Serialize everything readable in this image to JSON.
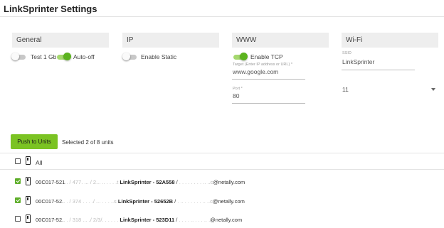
{
  "app": {
    "title": "LinkSprinter Settings"
  },
  "panels": {
    "general": {
      "header": "General",
      "test1gb_label": "Test 1 Gb",
      "autooff_label": "Auto-off",
      "test1gb_on": false,
      "autooff_on": true
    },
    "ip": {
      "header": "IP",
      "enable_static_label": "Enable Static",
      "enable_static_on": false
    },
    "www": {
      "header": "WWW",
      "enable_tcp_label": "Enable TCP",
      "enable_tcp_on": true,
      "target_label": "Target (Enter IP address or URL) *",
      "target_value": "www.google.com",
      "port_label": "Port *",
      "port_value": "80"
    },
    "wifi": {
      "header": "Wi-Fi",
      "ssid_label": "SSID",
      "ssid_value": "LinkSprinter",
      "channel_value": "11"
    }
  },
  "actions": {
    "push_label": "Push to Units",
    "selected_text": "Selected 2 of 8 units"
  },
  "units": {
    "all_label": "All",
    "rows": [
      {
        "checked": true,
        "id": "00C017-521",
        "mid": ".. / 477. ... / 2... .. . . . .t",
        "name": "LinkSprinter - 52A558",
        "sep": " / ",
        "email_blur": ". . . . . . . . .. ..c",
        "email": "@netally.com"
      },
      {
        "checked": true,
        "id": "00C017-52.",
        "mid": ". . / 374 . . . ./ ... . . . ..s",
        "name": "LinkSprinter - 52652B",
        "sep": " / ",
        "email_blur": ". .. . . . . . . .. ..c",
        "email": "@netally.com"
      },
      {
        "checked": false,
        "id": "00C017-52.",
        "mid": ". . / 318 ... ./ 2/3/. . . . . .",
        "name": "LinkSprinter - 523D11",
        "sep": " / ",
        "email_blur": ". . . . .. . . . .. .",
        "email": "@netally.com"
      }
    ]
  },
  "colors": {
    "accent": "#7bc323",
    "toggle_on": "#5bb31e",
    "checkbox": "#5fae2b"
  }
}
